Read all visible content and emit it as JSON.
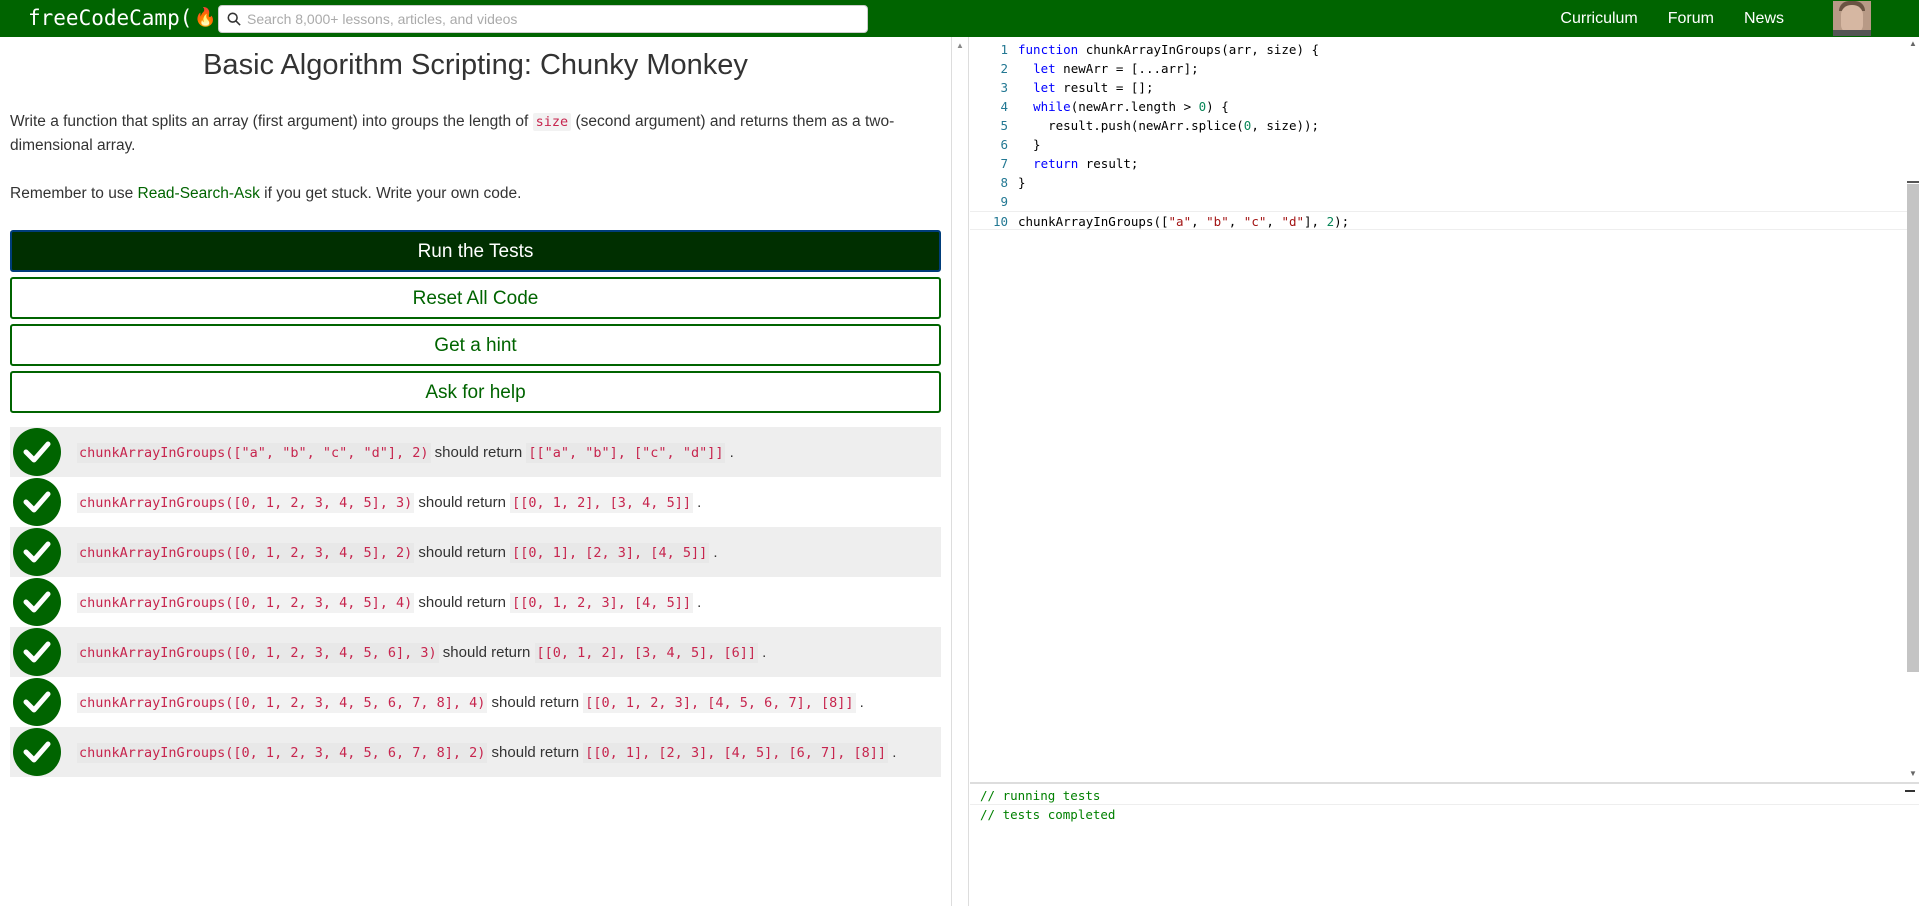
{
  "navbar": {
    "logo_text": "freeCodeCamp(",
    "logo_flame": "🔥",
    "logo_close": ")",
    "search_placeholder": "Search 8,000+ lessons, articles, and videos",
    "links": [
      "Curriculum",
      "Forum",
      "News"
    ]
  },
  "challenge": {
    "title": "Basic Algorithm Scripting: Chunky Monkey",
    "description_pre": "Write a function that splits an array (first argument) into groups the length of ",
    "description_code": "size",
    "description_post": " (second argument) and returns them as a two-dimensional array.",
    "reminder_pre": "Remember to use ",
    "reminder_link": "Read-Search-Ask",
    "reminder_post": " if you get stuck. Write your own code."
  },
  "buttons": {
    "run": "Run the Tests",
    "reset": "Reset All Code",
    "hint": "Get a hint",
    "help": "Ask for help"
  },
  "tests": [
    {
      "call": "chunkArrayInGroups([\"a\", \"b\", \"c\", \"d\"], 2)",
      "mid": " should return ",
      "expected": "[[\"a\", \"b\"], [\"c\", \"d\"]]",
      "end": "."
    },
    {
      "call": "chunkArrayInGroups([0, 1, 2, 3, 4, 5], 3)",
      "mid": " should return ",
      "expected": "[[0, 1, 2], [3, 4, 5]]",
      "end": "."
    },
    {
      "call": "chunkArrayInGroups([0, 1, 2, 3, 4, 5], 2)",
      "mid": " should return ",
      "expected": "[[0, 1], [2, 3], [4, 5]]",
      "end": "."
    },
    {
      "call": "chunkArrayInGroups([0, 1, 2, 3, 4, 5], 4)",
      "mid": " should return ",
      "expected": "[[0, 1, 2, 3], [4, 5]]",
      "end": "."
    },
    {
      "call": "chunkArrayInGroups([0, 1, 2, 3, 4, 5, 6], 3)",
      "mid": " should return ",
      "expected": "[[0, 1, 2], [3, 4, 5], [6]]",
      "end": "."
    },
    {
      "call": "chunkArrayInGroups([0, 1, 2, 3, 4, 5, 6, 7, 8], 4)",
      "mid": " should return ",
      "expected": "[[0, 1, 2, 3], [4, 5, 6, 7], [8]]",
      "end": "."
    },
    {
      "call": "chunkArrayInGroups([0, 1, 2, 3, 4, 5, 6, 7, 8], 2)",
      "mid": " should return ",
      "expected": "[[0, 1], [2, 3], [4, 5], [6, 7], [8]]",
      "end": "."
    }
  ],
  "editor": {
    "line_numbers": [
      "1",
      "2",
      "3",
      "4",
      "5",
      "6",
      "7",
      "8",
      "9",
      "10"
    ],
    "lines": [
      "function chunkArrayInGroups(arr, size) {",
      "  let newArr = [...arr];",
      "  let result = [];",
      "  while(newArr.length > 0) {",
      "    result.push(newArr.splice(0, size));",
      "  }",
      "  return result;",
      "}",
      "",
      "chunkArrayInGroups([\"a\", \"b\", \"c\", \"d\"], 2);"
    ]
  },
  "console": {
    "lines": [
      "// running tests",
      "// tests completed"
    ]
  },
  "colors": {
    "brand": "#006400",
    "run_button": "#002f00",
    "code_red": "#c7254e"
  }
}
